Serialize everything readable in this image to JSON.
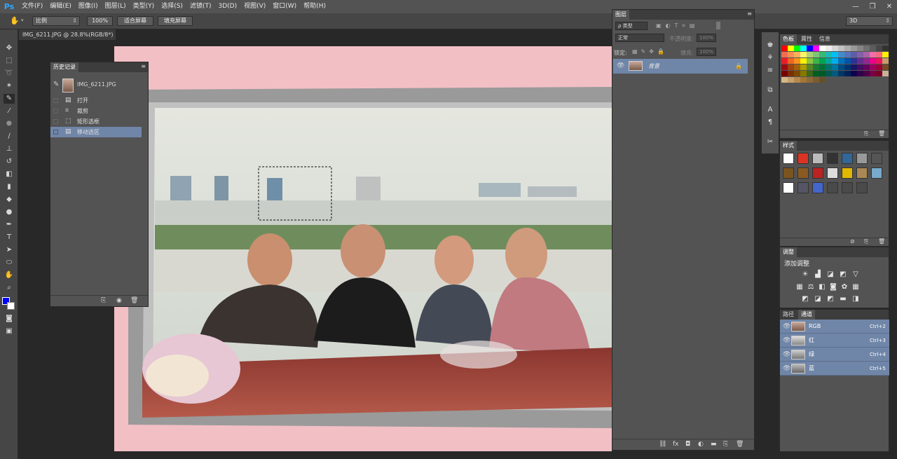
{
  "app": {
    "logo": "Ps"
  },
  "menu": [
    "文件(F)",
    "编辑(E)",
    "图像(I)",
    "图层(L)",
    "类型(Y)",
    "选择(S)",
    "滤镜(T)",
    "3D(D)",
    "视图(V)",
    "窗口(W)",
    "帮助(H)"
  ],
  "window_controls": [
    "—",
    "❐",
    "✕"
  ],
  "options": {
    "hand_icon": "hand-icon",
    "ratio_label": "比例",
    "zoom_value": "100%",
    "fit_screen": "适合屏幕",
    "fill_screen": "填充屏幕",
    "mode_3d": "3D"
  },
  "document": {
    "tab_title": "IMG_6211.JPG @ 28.8%(RGB/8*) *"
  },
  "history": {
    "title": "历史记录",
    "snapshot": "IMG_6211.JPG",
    "items": [
      "打开",
      "裁剪",
      "矩形选框",
      "移动选区"
    ],
    "selected_index": 3
  },
  "layers": {
    "title": "图层",
    "filter_label": "ρ 类型",
    "blend_mode": "正常",
    "opacity_label": "不透明度:",
    "opacity_value": "100%",
    "lock_label": "锁定:",
    "fill_label": "填充:",
    "fill_value": "100%",
    "layer_name": "背景"
  },
  "swatches": {
    "tabs": [
      "色板",
      "属性",
      "信息"
    ]
  },
  "styles": {
    "title": "样式"
  },
  "adjustments": {
    "title": "调整",
    "add_label": "添加调整"
  },
  "channels": {
    "tabs": [
      "路径",
      "通道"
    ],
    "rows": [
      {
        "name": "RGB",
        "shortcut": "Ctrl+2"
      },
      {
        "name": "红",
        "shortcut": "Ctrl+3"
      },
      {
        "name": "绿",
        "shortcut": "Ctrl+4"
      },
      {
        "name": "蓝",
        "shortcut": "Ctrl+5"
      }
    ]
  },
  "colors": {
    "foreground": "#0000ff",
    "background": "#ffffff",
    "accent_selection": "#7086a8"
  }
}
